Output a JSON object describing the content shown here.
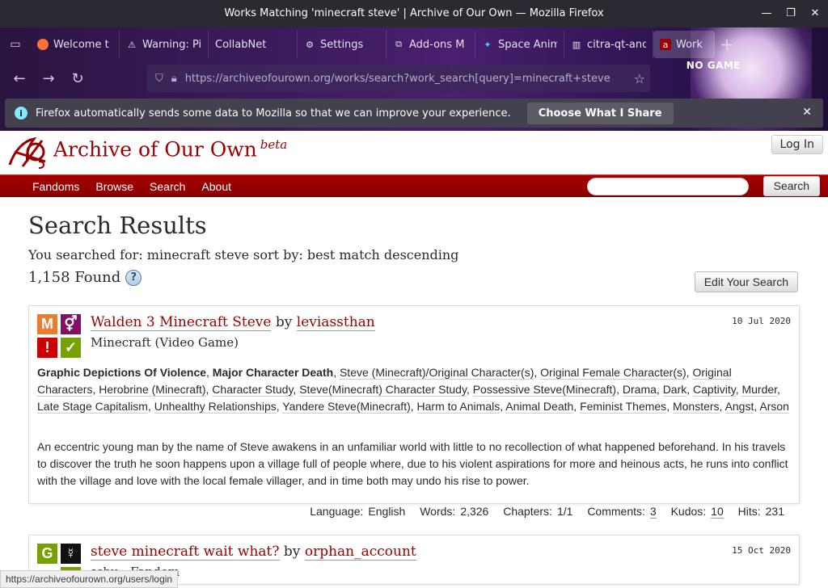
{
  "window": {
    "title": "Works Matching 'minecraft steve' | Archive of Our Own — Mozilla Firefox"
  },
  "tabs": [
    {
      "label": "Welcome t",
      "icon": "firefox-icon"
    },
    {
      "label": "Warning: Pi",
      "icon": "warning-icon"
    },
    {
      "label": "CollabNet",
      "icon": ""
    },
    {
      "label": "Settings",
      "icon": "gear-icon"
    },
    {
      "label": "Add-ons M",
      "icon": "puzzle-icon"
    },
    {
      "label": "Space Anim",
      "icon": "space-icon"
    },
    {
      "label": "citra-qt-and",
      "icon": "github-icon"
    },
    {
      "label": "Work",
      "icon": "ao3-icon"
    }
  ],
  "urlbar": {
    "url": "https://archiveofourown.org/works/search?work_search[query]=minecraft+steve"
  },
  "theme": {
    "art_text": "NO GAME"
  },
  "notification": {
    "text": "Firefox automatically sends some data to Mozilla so that we can improve your experience.",
    "button": "Choose What I Share"
  },
  "site": {
    "title": "Archive of Our Own",
    "beta": "beta",
    "login": "Log In"
  },
  "nav": {
    "items": [
      "Fandoms",
      "Browse",
      "Search",
      "About"
    ],
    "search_button": "Search"
  },
  "results": {
    "heading": "Search Results",
    "searched_for": "You searched for: minecraft steve sort by: best match descending",
    "found": "1,158 Found",
    "help": "?",
    "edit_button": "Edit Your Search"
  },
  "works": [
    {
      "title": "Walden 3 Minecraft Steve",
      "by": "by",
      "author": "leviassthan",
      "fandom": "Minecraft (Video Game)",
      "date": "10 Jul 2020",
      "required_tags": {
        "rating": "M",
        "category": "⚥",
        "warning": "!",
        "complete": "✓"
      },
      "warnings": [
        "Graphic Depictions Of Violence",
        "Major Character Death"
      ],
      "tags": [
        "Steve (Minecraft)/Original Character(s)",
        "Original Female Character(s)",
        "Original Characters",
        "Herobrine (Minecraft)",
        "Character Study",
        "Steve(Minecraft) Character Study",
        "Possessive Steve(Minecraft)",
        "Drama",
        "Dark",
        "Captivity",
        "Murder",
        "Late Stage Capitalism",
        "Unhealthy Relationships",
        "Yandere Steve(Minecraft)",
        "Harm to Animals",
        "Animal Death",
        "Feminist Themes",
        "Monsters",
        "Angst",
        "Arson"
      ],
      "summary": "An eccentric young man by the name of Steve awakens in an unfamiliar world with little to no recollection of what happened beforehand. In his travels to discover the truth he soon happens upon a village full of people where, due to his violent aspirations for more and heinous acts, he runs into conflict with the village and love with the local female villager, and in time both may undo his rise to power.",
      "stats": {
        "language_label": "Language:",
        "language": "English",
        "words_label": "Words:",
        "words": "2,326",
        "chapters_label": "Chapters:",
        "chapters": "1/1",
        "comments_label": "Comments:",
        "comments": "3",
        "kudos_label": "Kudos:",
        "kudos": "10",
        "hits_label": "Hits:",
        "hits": "231"
      }
    },
    {
      "title": "steve minecraft wait what?",
      "by": "by",
      "author": "orphan_account",
      "fandom": "ssbu - Fandom",
      "date": "15 Oct 2020",
      "required_tags": {
        "rating": "G",
        "category": "☿",
        "complete": "✓"
      }
    }
  ],
  "statusbar": {
    "text": "https://archiveofourown.org/users/login"
  },
  "colors": {
    "ao3_red": "#990000",
    "nav_red": "#a50000",
    "rating_m": "#e87d2f",
    "rating_g": "#77a100",
    "category": "#840d67",
    "warning": "#cc0000",
    "complete": "#77a100"
  }
}
